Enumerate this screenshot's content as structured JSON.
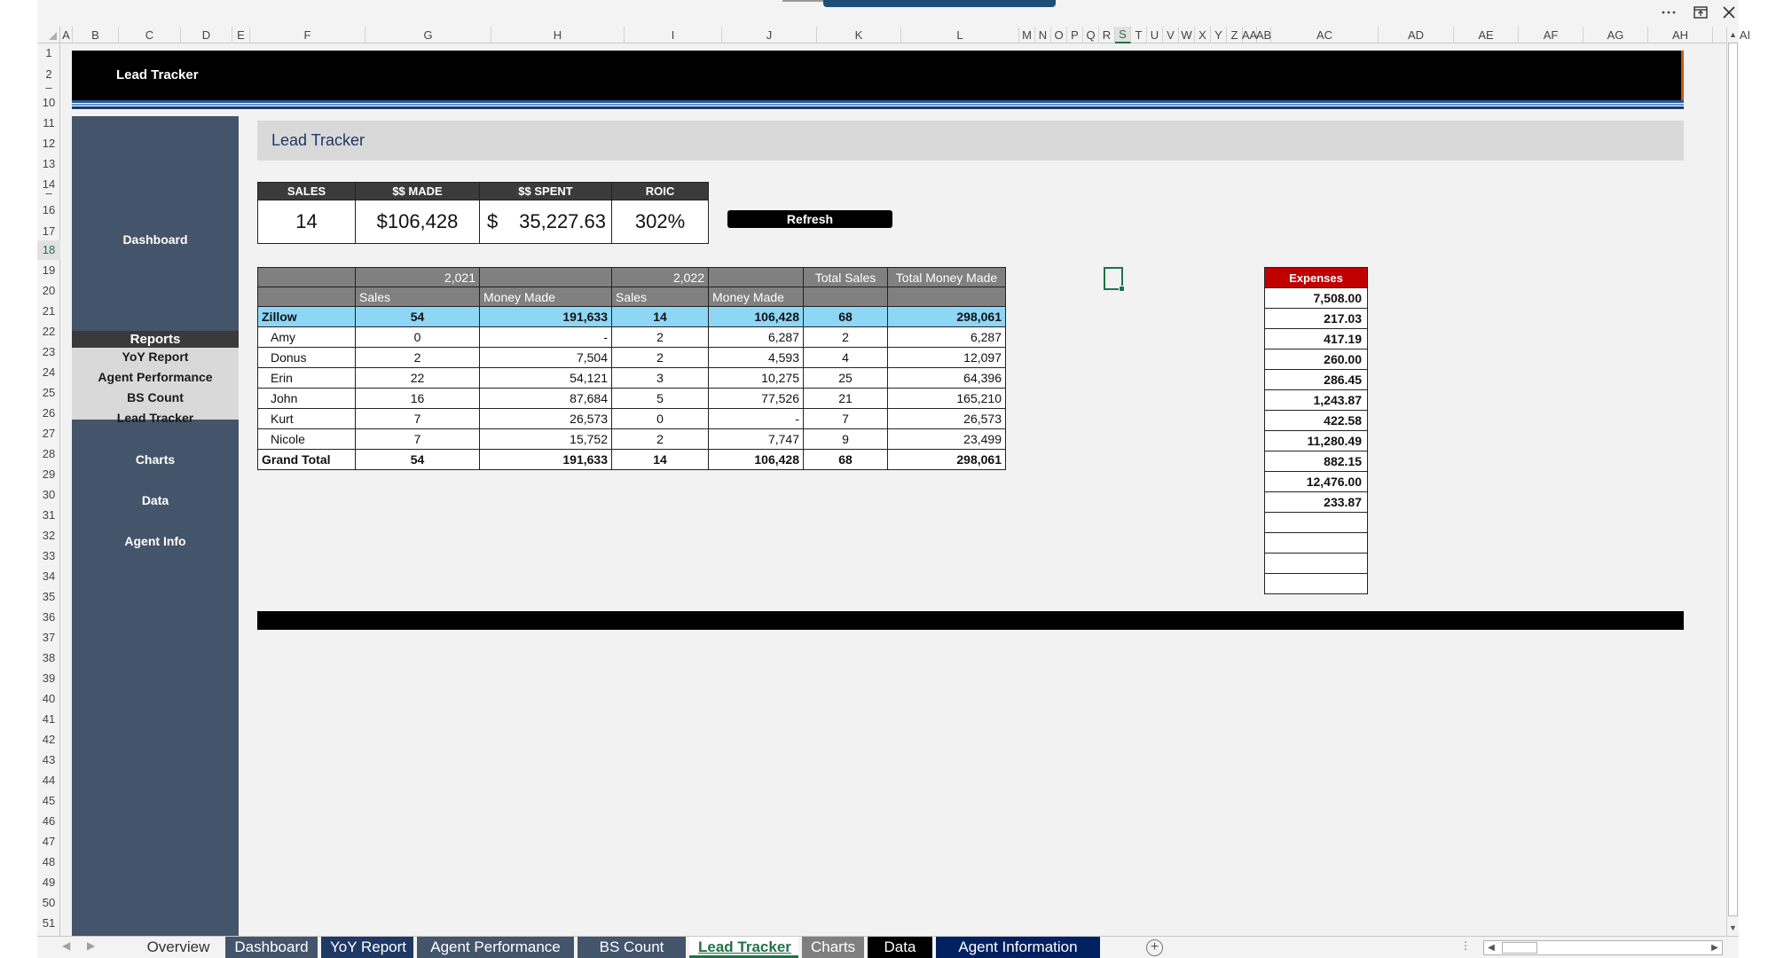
{
  "window": {
    "controls": [
      "more-icon",
      "restore-icon",
      "close-icon"
    ]
  },
  "columns": [
    "A",
    "B",
    "C",
    "D",
    "E",
    "F",
    "G",
    "H",
    "I",
    "J",
    "K",
    "L",
    "M",
    "N",
    "O",
    "P",
    "Q",
    "R",
    "S",
    "T",
    "U",
    "V",
    "W",
    "X",
    "Y",
    "Z",
    "AA",
    "AB",
    "AC",
    "AD",
    "AE",
    "AF",
    "AG",
    "AH",
    "AI"
  ],
  "selected_column": "S",
  "rows": [
    "1",
    "2",
    "",
    "10",
    "11",
    "12",
    "13",
    "14",
    "",
    "16",
    "17",
    "18",
    "19",
    "20",
    "21",
    "22",
    "23",
    "24",
    "25",
    "26",
    "27",
    "28",
    "29",
    "30",
    "31",
    "32",
    "33",
    "34",
    "35",
    "36",
    "37",
    "38",
    "39",
    "40",
    "41",
    "42",
    "43",
    "44",
    "45",
    "46",
    "47",
    "48",
    "49",
    "50",
    "51"
  ],
  "selected_row": "18",
  "banner": {
    "title": "Lead Tracker"
  },
  "sidebar": {
    "dashboard": "Dashboard",
    "reports_header": "Reports",
    "reports": [
      "YoY Report",
      "Agent Performance",
      "BS Count",
      "Lead Tracker"
    ],
    "charts": "Charts",
    "data": "Data",
    "agent_info": "Agent Info"
  },
  "section_title": "Lead Tracker",
  "kpi": {
    "headers": [
      "SALES",
      "$$ MADE",
      "$$ SPENT",
      "ROIC"
    ],
    "sales": "14",
    "made": "$106,428",
    "spent_symbol": "$",
    "spent": "35,227.63",
    "roic": "302%"
  },
  "refresh_button": "Refresh",
  "pivot": {
    "year1": "2,021",
    "year2": "2,022",
    "total_sales": "Total Sales",
    "total_money": "Total Money Made",
    "sub_sales": "Sales",
    "sub_money": "Money Made",
    "rows": [
      [
        "Zillow",
        "54",
        "191,633",
        "14",
        "106,428",
        "68",
        "298,061"
      ],
      [
        "Amy",
        "0",
        "-",
        "2",
        "6,287",
        "2",
        "6,287"
      ],
      [
        "Donus",
        "2",
        "7,504",
        "2",
        "4,593",
        "4",
        "12,097"
      ],
      [
        "Erin",
        "22",
        "54,121",
        "3",
        "10,275",
        "25",
        "64,396"
      ],
      [
        "John",
        "16",
        "87,684",
        "5",
        "77,526",
        "21",
        "165,210"
      ],
      [
        "Kurt",
        "7",
        "26,573",
        "0",
        "-",
        "7",
        "26,573"
      ],
      [
        "Nicole",
        "7",
        "15,752",
        "2",
        "7,747",
        "9",
        "23,499"
      ]
    ],
    "grand_total": [
      "Grand Total",
      "54",
      "191,633",
      "14",
      "106,428",
      "68",
      "298,061"
    ]
  },
  "expenses": {
    "header": "Expenses",
    "values": [
      "7,508.00",
      "217.03",
      "417.19",
      "260.00",
      "286.45",
      "1,243.87",
      "422.58",
      "11,280.49",
      "882.15",
      "12,476.00",
      "233.87",
      "",
      "",
      "",
      ""
    ]
  },
  "tabs": [
    {
      "label": "Overview",
      "bg": "#f3f3f3",
      "fg": "#333333"
    },
    {
      "label": "Dashboard",
      "bg": "#44546a",
      "fg": "#ffffff"
    },
    {
      "label": "YoY Report",
      "bg": "#1f3864",
      "fg": "#ffffff"
    },
    {
      "label": "Agent Performance",
      "bg": "#44546a",
      "fg": "#ffffff"
    },
    {
      "label": "BS Count",
      "bg": "#44546a",
      "fg": "#ffffff"
    },
    {
      "label": "Lead Tracker",
      "bg": "#ffffff",
      "fg": "#217346",
      "active": true
    },
    {
      "label": "Charts",
      "bg": "#7f7f7f",
      "fg": "#ffffff"
    },
    {
      "label": "Data",
      "bg": "#000000",
      "fg": "#ffffff"
    },
    {
      "label": "Agent Information",
      "bg": "#002060",
      "fg": "#ffffff"
    }
  ],
  "colors": {
    "excel_green": "#217346",
    "sidebar": "#44546a",
    "expenses_header": "#c00000",
    "zillow_row": "#8ed6f5"
  }
}
